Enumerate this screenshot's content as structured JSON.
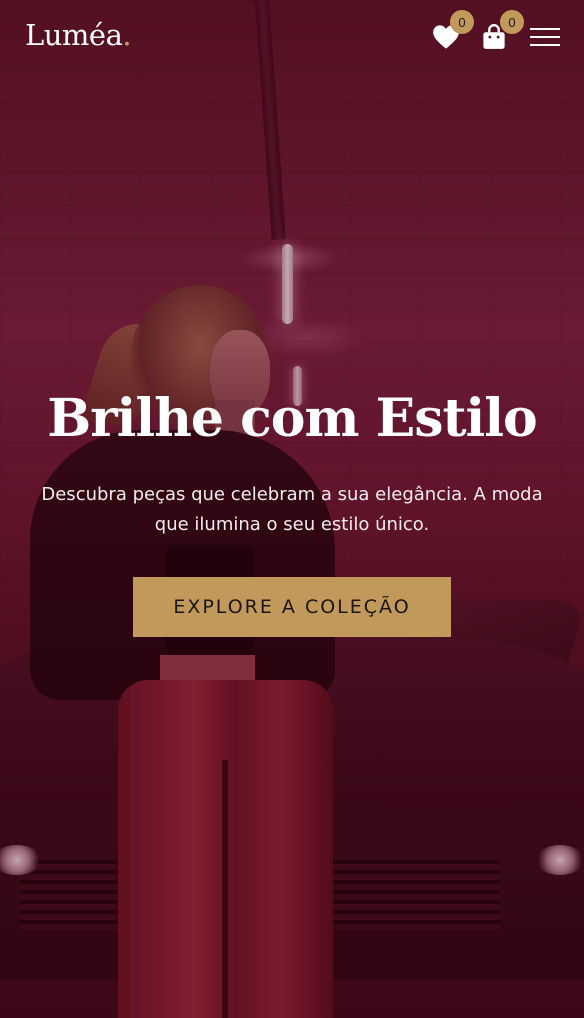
{
  "header": {
    "logo_text": "Luméa",
    "logo_dot": ".",
    "wishlist": {
      "icon": "heart-icon",
      "count": "0"
    },
    "cart": {
      "icon": "shopping-bag-icon",
      "count": "0"
    },
    "menu_icon": "hamburger-menu-icon"
  },
  "hero": {
    "title": "Brilhe com Estilo",
    "subtitle": "Descubra peças que celebram a sua elegância. A moda que ilumina o seu estilo único.",
    "cta_label": "EXPLORE A COLEÇÃO"
  },
  "colors": {
    "accent": "#c19a5b",
    "overlay": "#5a1527",
    "text": "#ffffff"
  }
}
